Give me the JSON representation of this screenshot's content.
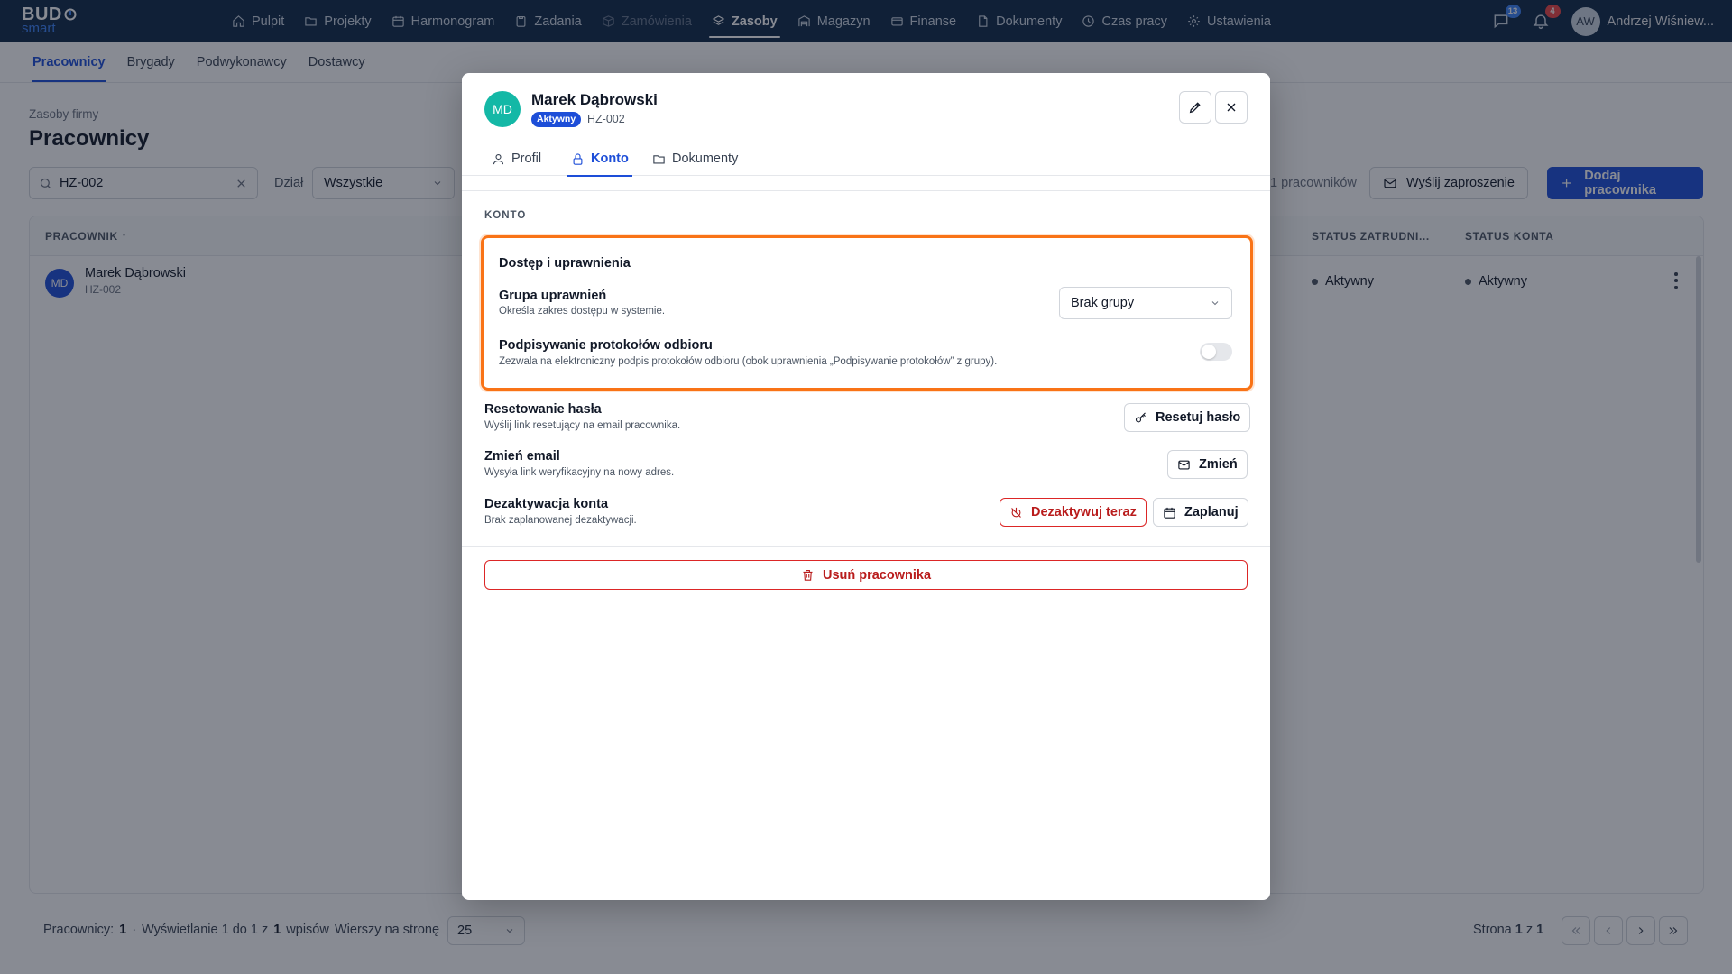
{
  "brand": {
    "line1": "BUD",
    "line2": "smart"
  },
  "nav": [
    {
      "label": "Pulpit",
      "icon": "home-icon"
    },
    {
      "label": "Projekty",
      "icon": "folder-icon"
    },
    {
      "label": "Harmonogram",
      "icon": "calendar-icon"
    },
    {
      "label": "Zadania",
      "icon": "clipboard-icon"
    },
    {
      "label": "Zamówienia",
      "icon": "box-icon"
    },
    {
      "label": "Zasoby",
      "icon": "layers-icon"
    },
    {
      "label": "Magazyn",
      "icon": "warehouse-icon"
    },
    {
      "label": "Finanse",
      "icon": "card-icon"
    },
    {
      "label": "Dokumenty",
      "icon": "document-icon"
    },
    {
      "label": "Czas pracy",
      "icon": "clock-icon"
    },
    {
      "label": "Ustawienia",
      "icon": "gear-icon"
    }
  ],
  "topRight": {
    "messagesCount": "13",
    "notificationsCount": "4",
    "userInitials": "AW",
    "userName": "Andrzej Wiśniew..."
  },
  "subtabs": [
    "Pracownicy",
    "Brygady",
    "Podwykonawcy",
    "Dostawcy"
  ],
  "page": {
    "crumb": "Zasoby firmy",
    "title": "Pracownicy",
    "searchValue": "HZ-002",
    "filterLabel": "Dział",
    "filterValue": "Wszystkie",
    "countText": "1 pracowników",
    "inviteLabel": "Wyślij zaproszenie",
    "addLabel": "Dodaj pracownika"
  },
  "table": {
    "headers": {
      "employee": "PRACOWNIK",
      "employment": "STATUS ZATRUDNI...",
      "account": "STATUS KONTA"
    },
    "rows": [
      {
        "initials": "MD",
        "name": "Marek Dąbrowski",
        "id": "HZ-002",
        "employment": "Aktywny",
        "account": "Aktywny"
      }
    ]
  },
  "footer": {
    "countLabel": "Pracownicy:",
    "countValue": "1",
    "separator": "·",
    "showing": "Wyświetlanie 1 do 1 z",
    "total": "1",
    "entries": "wpisów",
    "rowsLabel": "Wierszy na stronę",
    "rowsValue": "25",
    "pageLabel": "Strona",
    "pageCurrent": "1",
    "pageOf": "z",
    "pageTotal": "1"
  },
  "modal": {
    "initials": "MD",
    "name": "Marek Dąbrowski",
    "badge": "Aktywny",
    "id": "HZ-002",
    "tabs": [
      "Profil",
      "Konto",
      "Dokumenty"
    ],
    "sectionLabel": "KONTO",
    "access": {
      "title": "Dostęp i uprawnienia",
      "groupTitle": "Grupa uprawnień",
      "groupDesc": "Określa zakres dostępu w systemie.",
      "groupValue": "Brak grupy",
      "signTitle": "Podpisywanie protokołów odbioru",
      "signDesc": "Zezwala na elektroniczny podpis protokołów odbioru (obok uprawnienia „Podpisywanie protokołów” z grupy).",
      "signEnabled": false
    },
    "reset": {
      "title": "Resetowanie hasła",
      "desc": "Wyślij link resetujący na email pracownika.",
      "button": "Resetuj hasło"
    },
    "email": {
      "title": "Zmień email",
      "desc": "Wysyła link weryfikacyjny na nowy adres.",
      "button": "Zmień"
    },
    "deactivate": {
      "title": "Dezaktywacja konta",
      "desc": "Brak zaplanowanej dezaktywacji.",
      "nowButton": "Dezaktywuj teraz",
      "scheduleButton": "Zaplanuj"
    },
    "deleteButton": "Usuń pracownika"
  }
}
